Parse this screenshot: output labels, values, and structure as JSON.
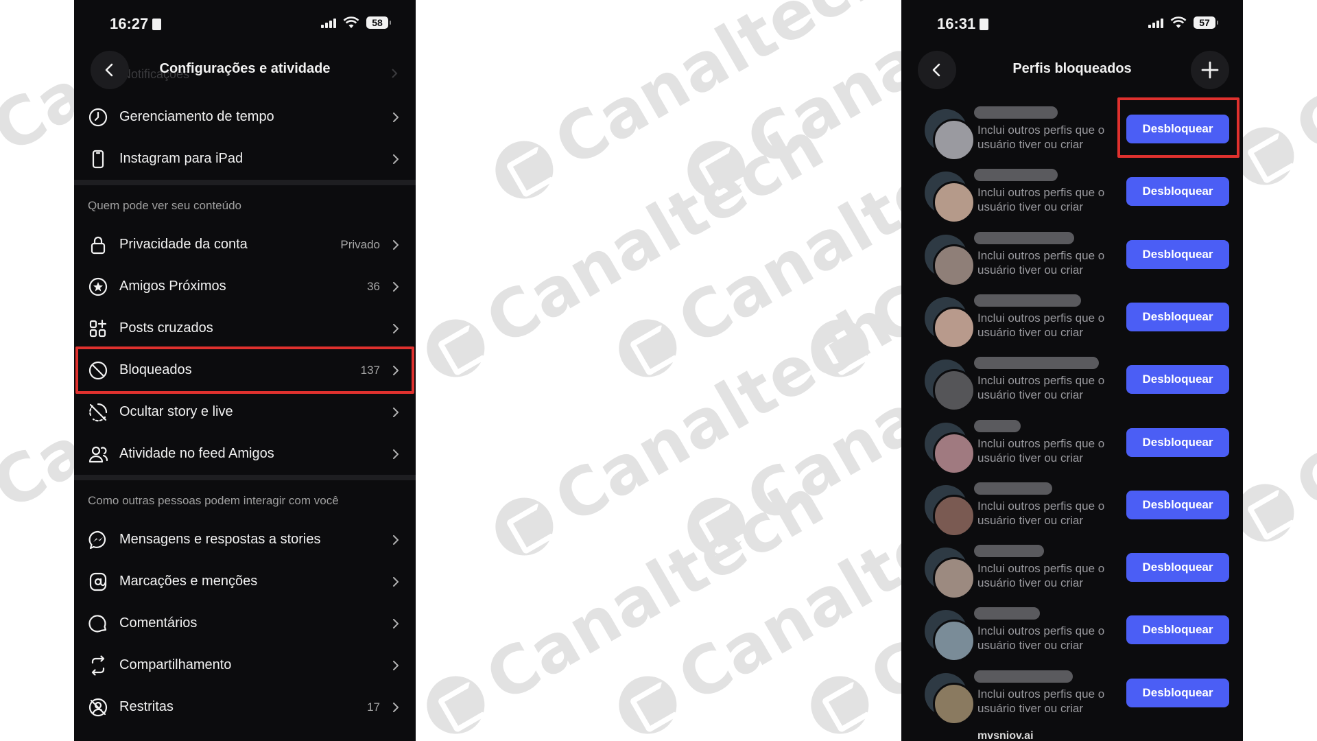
{
  "watermark": {
    "text": "Canaltech"
  },
  "left_phone": {
    "status": {
      "time": "16:27",
      "battery": "58"
    },
    "header": {
      "title": "Configurações e atividade",
      "behind_text": "Notificações"
    },
    "rows_top": [
      {
        "label": "Gerenciamento de tempo",
        "icon": "clock-icon"
      },
      {
        "label": "Instagram para iPad",
        "icon": "tablet-icon"
      }
    ],
    "section1_title": "Quem pode ver seu conteúdo",
    "rows_section1": [
      {
        "label": "Privacidade da conta",
        "value": "Privado",
        "icon": "lock-icon"
      },
      {
        "label": "Amigos Próximos",
        "value": "36",
        "icon": "star-circle-icon"
      },
      {
        "label": "Posts cruzados",
        "value": "",
        "icon": "grid-icon"
      },
      {
        "label": "Bloqueados",
        "value": "137",
        "icon": "block-icon"
      },
      {
        "label": "Ocultar story e live",
        "value": "",
        "icon": "hide-story-icon"
      },
      {
        "label": "Atividade no feed Amigos",
        "value": "",
        "icon": "friends-icon"
      }
    ],
    "section2_title": "Como outras pessoas podem interagir com você",
    "rows_section2": [
      {
        "label": "Mensagens e respostas a stories",
        "value": "",
        "icon": "messenger-icon"
      },
      {
        "label": "Marcações e menções",
        "value": "",
        "icon": "at-icon"
      },
      {
        "label": "Comentários",
        "value": "",
        "icon": "comment-icon"
      },
      {
        "label": "Compartilhamento",
        "value": "",
        "icon": "share-icon"
      },
      {
        "label": "Restritas",
        "value": "17",
        "icon": "restrict-icon"
      }
    ]
  },
  "right_phone": {
    "status": {
      "time": "16:31",
      "battery": "57"
    },
    "header": {
      "title": "Perfis bloqueados"
    },
    "subtitle": "Inclui outros perfis que o usuário tiver ou criar",
    "button_label": "Desbloquear",
    "accent": "#4b5ef5",
    "blocked_profiles": [
      {
        "name_hidden": true
      },
      {
        "name_hidden": true
      },
      {
        "name_hidden": true
      },
      {
        "name_hidden": true
      },
      {
        "name_hidden": true
      },
      {
        "name_hidden": true
      },
      {
        "name_hidden": true
      },
      {
        "name_hidden": true
      },
      {
        "name_hidden": true
      },
      {
        "name_hidden": true
      }
    ],
    "last_visible_username": "mvsniov.ai"
  },
  "highlight_color": "#e0312e"
}
